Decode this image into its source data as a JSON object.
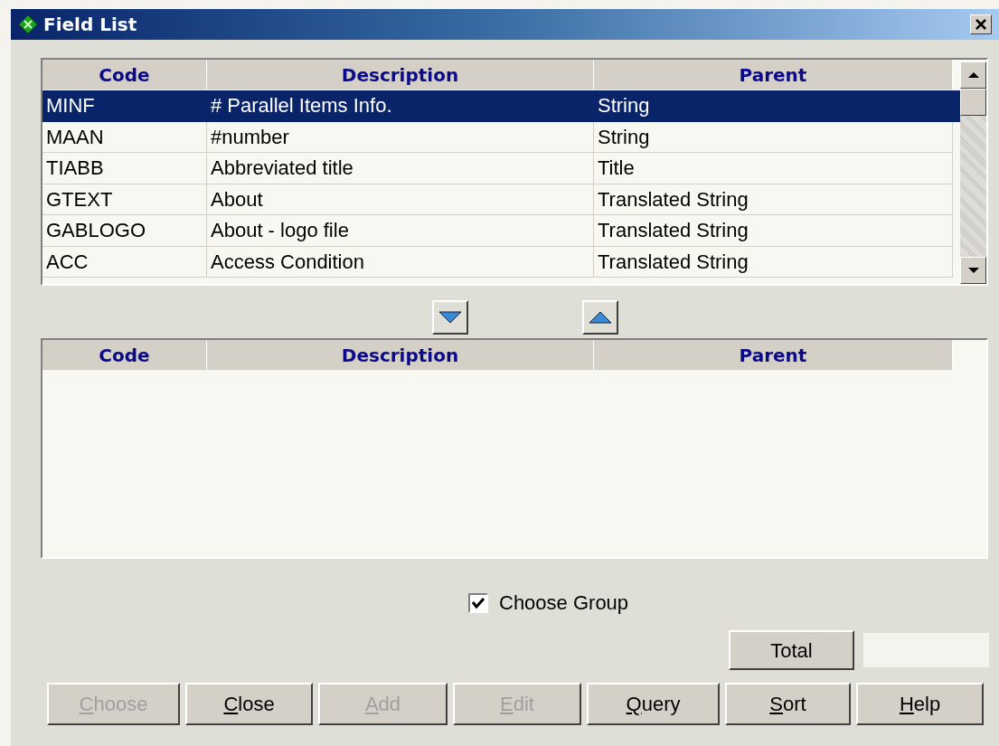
{
  "window": {
    "title": "Field List",
    "close": "×"
  },
  "fields_table": {
    "columns": [
      "Code",
      "Description",
      "Parent"
    ],
    "rows": [
      {
        "cells": [
          "MINF",
          "# Parallel Items Info.",
          "String"
        ],
        "selected": true
      },
      {
        "cells": [
          "MAAN",
          "#number",
          "String"
        ],
        "selected": false
      },
      {
        "cells": [
          "TIABB",
          "Abbreviated title",
          "Title"
        ],
        "selected": false
      },
      {
        "cells": [
          "GTEXT",
          "About",
          "Translated String"
        ],
        "selected": false
      },
      {
        "cells": [
          "GABLOGO",
          "About - logo file",
          "Translated String"
        ],
        "selected": false
      },
      {
        "cells": [
          "ACC",
          "Access Condition",
          "Translated String"
        ],
        "selected": false
      }
    ]
  },
  "move_buttons": [
    {
      "kind": "down"
    },
    {
      "kind": "up"
    }
  ],
  "chosen_table": {
    "columns": [
      "Code",
      "Description",
      "Parent"
    ]
  },
  "choose_group": {
    "label": "Choose Group",
    "checked": true
  },
  "total": {
    "label": "Total"
  },
  "buttons": [
    {
      "label": "Choose",
      "disabled": true,
      "underlined": true
    },
    {
      "label": "Close",
      "disabled": false,
      "underlined": true
    },
    {
      "label": "Add",
      "disabled": true,
      "underlined": true
    },
    {
      "label": "Edit",
      "disabled": true,
      "underlined": true
    },
    {
      "label": "Query",
      "disabled": false,
      "underlined": true
    },
    {
      "label": "Sort",
      "disabled": false,
      "underlined": true
    },
    {
      "label": "Help",
      "disabled": false,
      "underlined": true
    }
  ]
}
